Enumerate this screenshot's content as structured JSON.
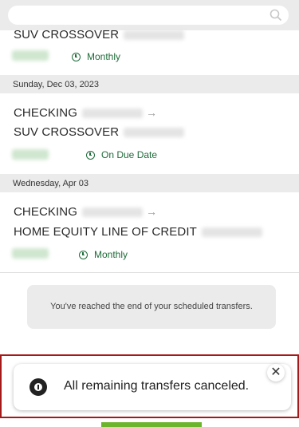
{
  "colors": {
    "accent_green": "#1f6b3a",
    "toast_frame": "#a41919",
    "action_green": "#6bb52d"
  },
  "icons": {
    "search": "search-icon",
    "clock": "clock-icon",
    "info": "info-icon",
    "close": "close-icon",
    "arrow": "arrow-right-icon"
  },
  "transfers": [
    {
      "to": "SUV CROSSOVER",
      "frequency": "Monthly"
    },
    {
      "date": "Sunday, Dec 03, 2023",
      "from": "CHECKING",
      "to": "SUV CROSSOVER",
      "frequency": "On Due Date"
    },
    {
      "date": "Wednesday, Apr 03",
      "from": "CHECKING",
      "to": "HOME EQUITY LINE OF CREDIT",
      "frequency": "Monthly"
    }
  ],
  "end_message": "You've reached the end of your scheduled transfers.",
  "toast": {
    "message": "All remaining transfers canceled.",
    "close_label": "✕"
  },
  "arrow_glyph": "→"
}
